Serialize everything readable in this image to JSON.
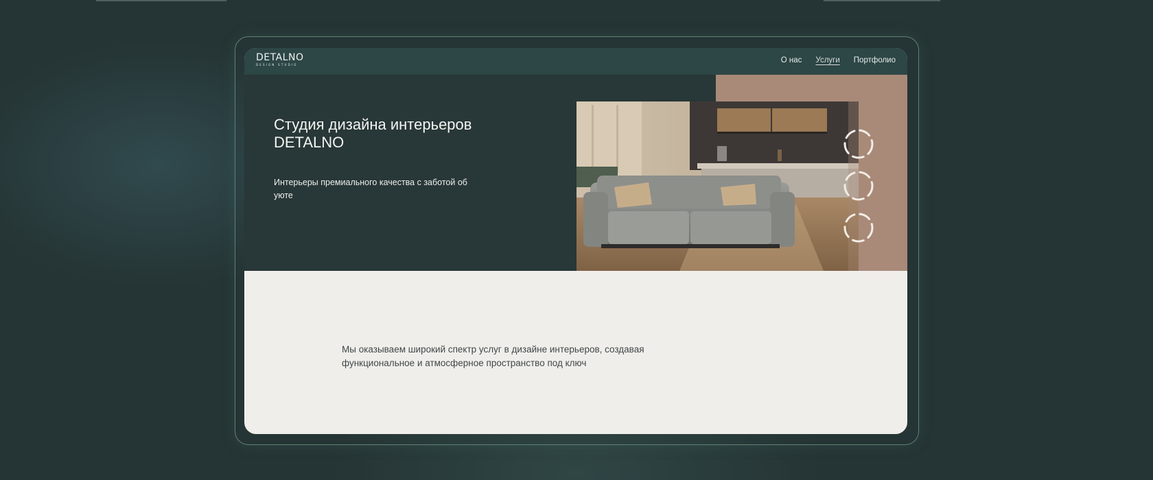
{
  "site": {
    "logo": {
      "name": "DETALNO",
      "tagline": "DESIGN STUDIO"
    },
    "nav": {
      "about": "О нас",
      "services": "Услуги",
      "portfolio": "Портфолио"
    },
    "hero": {
      "title": "Студия дизайна интерьеров DETALNO",
      "subtitle": "Интерьеры премиального качества с заботой об уюте"
    },
    "services_text": "Мы оказываем широкий спектр услуг в дизайне интерьеров, создавая функциональное и атмосферное пространство под ключ",
    "active_nav": "services"
  },
  "colors": {
    "page_background": "#253434",
    "navbar": "#2d4646",
    "hero_background": "#283737",
    "terracotta_accent": "#a98a78",
    "content_background": "#f0eeeb",
    "frame_border": "#5f8174"
  },
  "icons": {
    "carousel_indicator": "ring-icon"
  }
}
